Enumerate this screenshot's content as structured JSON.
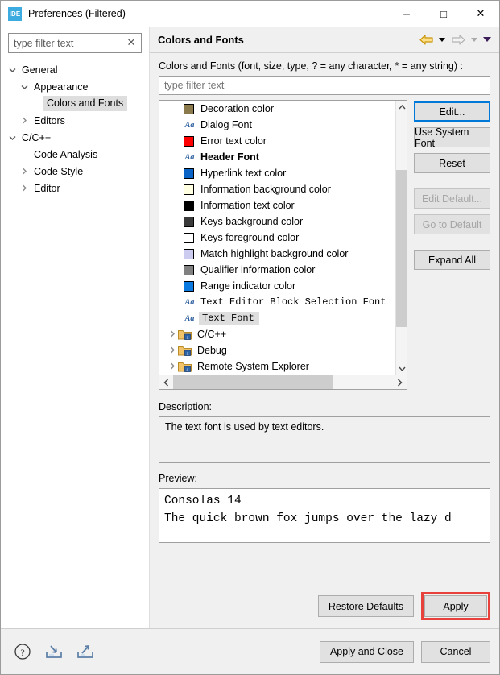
{
  "window": {
    "title": "Preferences (Filtered)",
    "app_icon": "IDE",
    "minimize": "–",
    "maximize": "□",
    "close": "✕"
  },
  "sidebar": {
    "filter": {
      "value": "type filter text",
      "clear": "✕"
    },
    "items": [
      {
        "label": "General",
        "indent": 0,
        "arrow": "down",
        "selected": false
      },
      {
        "label": "Appearance",
        "indent": 1,
        "arrow": "down",
        "selected": false
      },
      {
        "label": "Colors and Fonts",
        "indent": 2,
        "arrow": "none",
        "selected": true
      },
      {
        "label": "Editors",
        "indent": 1,
        "arrow": "right",
        "selected": false
      },
      {
        "label": "C/C++",
        "indent": 0,
        "arrow": "down",
        "selected": false
      },
      {
        "label": "Code Analysis",
        "indent": 1,
        "arrow": "none",
        "selected": false
      },
      {
        "label": "Code Style",
        "indent": 1,
        "arrow": "right",
        "selected": false
      },
      {
        "label": "Editor",
        "indent": 1,
        "arrow": "right",
        "selected": false
      }
    ]
  },
  "page": {
    "title": "Colors and Fonts",
    "nav": {
      "back": "back-arrow",
      "forward": "forward-arrow",
      "menu": "view-menu"
    },
    "filter_label": "Colors and Fonts (font, size, type, ? = any character, * = any string) :",
    "filter_placeholder": "type filter text",
    "filter_value": ""
  },
  "tree_list": {
    "items": [
      {
        "label": "Decoration color",
        "kind": "color",
        "color": "#8a7a4c",
        "selected": false,
        "bold": false,
        "mono": false
      },
      {
        "label": "Dialog Font",
        "kind": "font",
        "icon": "Aa",
        "selected": false,
        "bold": false,
        "mono": false
      },
      {
        "label": "Error text color",
        "kind": "color",
        "color": "#ff0000",
        "selected": false,
        "bold": false,
        "mono": false
      },
      {
        "label": "Header Font",
        "kind": "font",
        "icon": "Aa",
        "selected": false,
        "bold": true,
        "mono": false
      },
      {
        "label": "Hyperlink text color",
        "kind": "color",
        "color": "#0a64c8",
        "selected": false,
        "bold": false,
        "mono": false
      },
      {
        "label": "Information background color",
        "kind": "color",
        "color": "#ffffe1",
        "selected": false,
        "bold": false,
        "mono": false
      },
      {
        "label": "Information text color",
        "kind": "color",
        "color": "#000000",
        "selected": false,
        "bold": false,
        "mono": false
      },
      {
        "label": "Keys background color",
        "kind": "color",
        "color": "#3a3a3a",
        "selected": false,
        "bold": false,
        "mono": false
      },
      {
        "label": "Keys foreground color",
        "kind": "color",
        "color": "#ffffff",
        "selected": false,
        "bold": false,
        "mono": false
      },
      {
        "label": "Match highlight background color",
        "kind": "color",
        "color": "#ccccf0",
        "selected": false,
        "bold": false,
        "mono": false
      },
      {
        "label": "Qualifier information color",
        "kind": "color",
        "color": "#808080",
        "selected": false,
        "bold": false,
        "mono": false
      },
      {
        "label": "Range indicator color",
        "kind": "color",
        "color": "#0a7ae0",
        "selected": false,
        "bold": false,
        "mono": false
      },
      {
        "label": "Text Editor Block Selection Font",
        "kind": "font",
        "icon": "Aa",
        "selected": false,
        "bold": false,
        "mono": true
      },
      {
        "label": "Text Font",
        "kind": "font",
        "icon": "Aa",
        "selected": true,
        "bold": false,
        "mono": true
      }
    ],
    "nodes": [
      {
        "label": "C/C++",
        "arrow": "right"
      },
      {
        "label": "Debug",
        "arrow": "right"
      },
      {
        "label": "Remote System Explorer",
        "arrow": "right"
      }
    ]
  },
  "side_buttons": [
    {
      "label": "Edit...",
      "state": "focused"
    },
    {
      "label": "Use System Font",
      "state": "enabled"
    },
    {
      "label": "Reset",
      "state": "enabled"
    },
    {
      "label": "Edit Default...",
      "state": "disabled"
    },
    {
      "label": "Go to Default",
      "state": "disabled"
    },
    {
      "label": "Expand All",
      "state": "enabled"
    }
  ],
  "description": {
    "label": "Description:",
    "text": "The text font is used by text editors."
  },
  "preview": {
    "label": "Preview:",
    "line1": "Consolas 14",
    "line2": "The quick brown fox jumps over the lazy d"
  },
  "dialog_buttons": {
    "restore_defaults": "Restore Defaults",
    "apply": "Apply",
    "apply_and_close": "Apply and Close",
    "cancel": "Cancel"
  },
  "footer_icons": {
    "help": "help-icon",
    "import": "import-icon",
    "export": "export-icon"
  },
  "highlight_color": "#e8403a"
}
